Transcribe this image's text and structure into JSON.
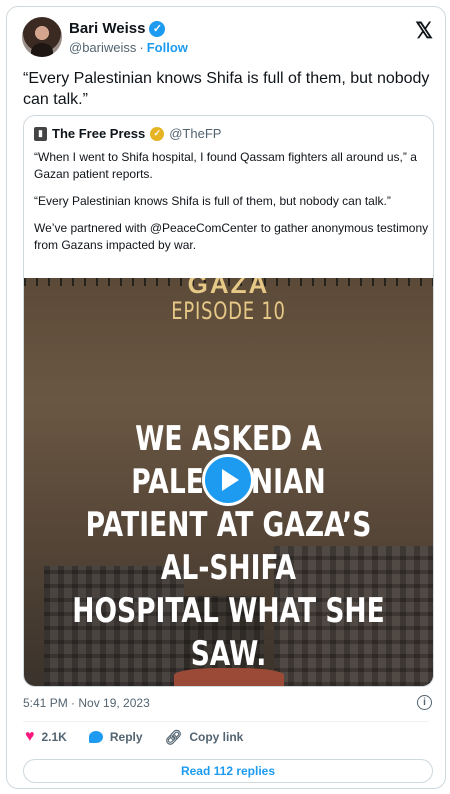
{
  "author": {
    "name": "Bari Weiss",
    "handle": "@bariweiss",
    "follow_label": "Follow",
    "separator": "·"
  },
  "tweet_text": "“Every Palestinian knows Shifa is full of them, but nobody can talk.”",
  "quote": {
    "name": "The Free Press",
    "handle": "@TheFP",
    "paragraphs": [
      "“When I went to Shifa hospital, I found Qassam fighters all around us,” a Gazan patient reports.",
      "“Every Palestinian knows Shifa is full of them, but nobody can talk.”",
      "We’ve partnered with @PeaceComCenter to gather anonymous testimony from Gazans impacted by war."
    ],
    "media": {
      "series_title": "GAZA",
      "episode": "EPISODE 10",
      "headline_line1": "WE ASKED A PALESTINIAN",
      "headline_line2": "PATIENT AT GAZA’S AL-SHIFA",
      "headline_line3": "HOSPITAL WHAT SHE SAW."
    }
  },
  "timestamp": "5:41 PM · Nov 19, 2023",
  "actions": {
    "likes": "2.1K",
    "reply": "Reply",
    "copy_link": "Copy link"
  },
  "read_replies": "Read 112 replies",
  "colors": {
    "accent": "#1d9bf0",
    "like": "#f91880",
    "verified_gold": "#e6b422"
  }
}
